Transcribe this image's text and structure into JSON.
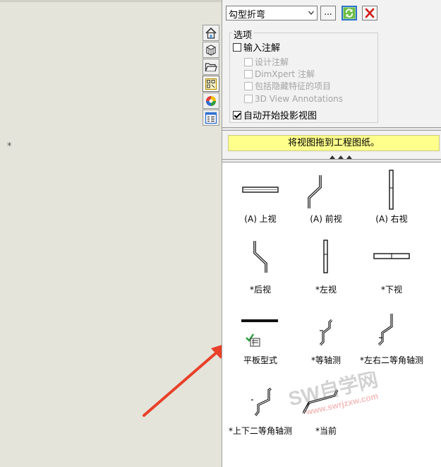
{
  "pane": {
    "sheet_select": "勾型折弯",
    "browse_label": "...",
    "options": {
      "title": "选项",
      "import_annotations": "输入注解",
      "design_annotations": "设计注解",
      "dimxpert_annotations": "DimXpert 注解",
      "include_hidden": "包括隐藏特征的项目",
      "annotations_3d": "3D View Annotations",
      "auto_projected": "自动开始投影视图"
    },
    "hint": "将视图拖到工程图纸。"
  },
  "views": [
    {
      "label": "(A) 上视"
    },
    {
      "label": "(A) 前视"
    },
    {
      "label": "(A) 右视"
    },
    {
      "label": "*后视"
    },
    {
      "label": "*左视"
    },
    {
      "label": "*下视"
    },
    {
      "label": "平板型式"
    },
    {
      "label": "*等轴测"
    },
    {
      "label": "*左右二等角轴测"
    },
    {
      "label": "*上下二等角轴测"
    },
    {
      "label": "*当前"
    }
  ],
  "sheet": {
    "marker": "*"
  },
  "watermark": {
    "brand": "SW自学网",
    "url": "www.swrjzxw.com"
  },
  "colors": {
    "hint_bg": "#ffff8c",
    "arrow": "#e8402a",
    "refresh_border": "#2f73c9",
    "close_icon": "#d11b1b"
  },
  "icons": [
    "home-icon",
    "parts-library-icon",
    "folder-icon",
    "view-palette-icon",
    "appearance-icon",
    "properties-icon",
    "refresh-icon",
    "close-icon",
    "chevron-down-icon"
  ]
}
